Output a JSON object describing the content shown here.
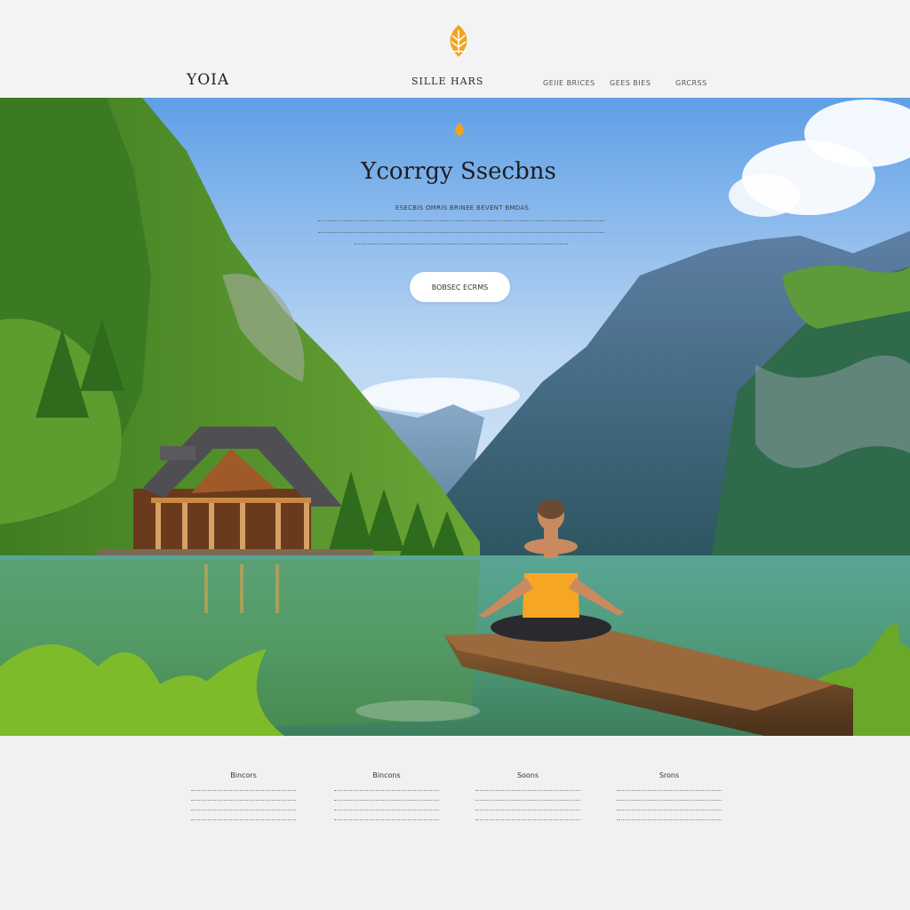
{
  "header": {
    "brand": "YOIA",
    "center_title": "SILLE HARS",
    "nav": [
      "GEIIE BRICES",
      "GEES BIES",
      "GRCRSS"
    ]
  },
  "hero": {
    "title": "Ycorrgy Ssecbns",
    "subtitle": "ESECBIS OMRIS BRINEE BEVENT BMDAS",
    "cta_label": "BOBSEC ECRMS",
    "description_lines": 3
  },
  "features": [
    {
      "title": "Bincors"
    },
    {
      "title": "Bincons"
    },
    {
      "title": "Soons"
    },
    {
      "title": "Srons"
    }
  ],
  "colors": {
    "accent": "#f2a31c",
    "sky_top": "#5f9fe6",
    "lake": "#5fa58f",
    "forest": "#4a8a2a"
  },
  "icons": {
    "logo": "lotus-icon",
    "hero_mark": "lotus-small-icon"
  }
}
